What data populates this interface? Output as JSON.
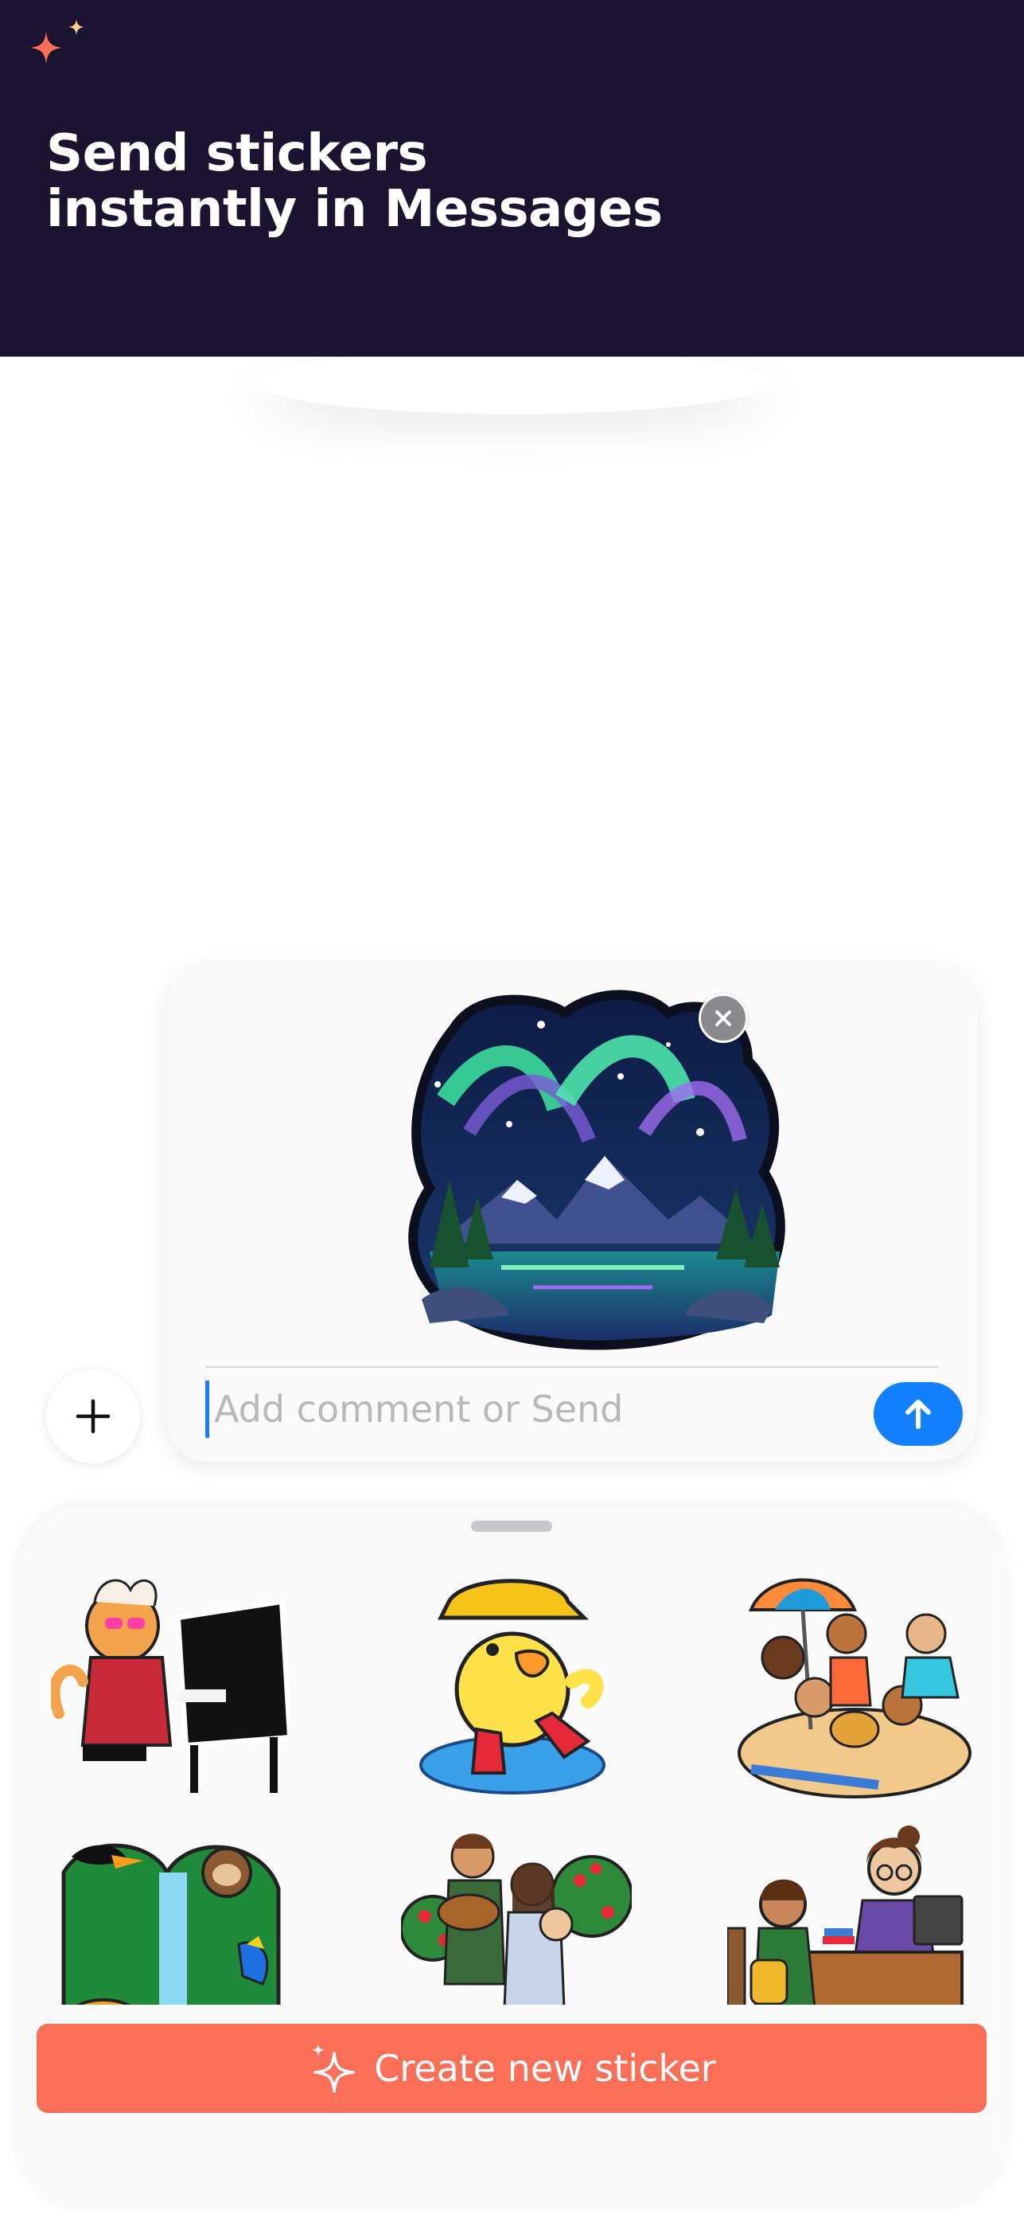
{
  "hero": {
    "title_line1": "Send stickers",
    "title_line2": "instantly in Messages",
    "background": "#1b1330",
    "sparkle_color": "#fb6e57",
    "icon": "sparkle-icon"
  },
  "compose": {
    "sticker": {
      "subject": "aurora-mountain-lake-sticker"
    },
    "remove_icon": "close-icon",
    "input_placeholder": "Add comment or Send",
    "input_value": "",
    "send_icon": "arrow-up-icon",
    "send_color": "#1280ff",
    "plus_icon": "plus-icon"
  },
  "drawer": {
    "stickers": [
      {
        "subject": "cat-pianist-sticker"
      },
      {
        "subject": "duck-rain-boots-sticker"
      },
      {
        "subject": "beach-friends-sticker"
      },
      {
        "subject": "jungle-animals-sticker"
      },
      {
        "subject": "apple-picking-family-sticker"
      },
      {
        "subject": "library-desk-sticker"
      }
    ],
    "create_button_label": "Create new sticker",
    "create_button_icon": "sparkles-icon",
    "create_button_color": "#fb6e57"
  }
}
